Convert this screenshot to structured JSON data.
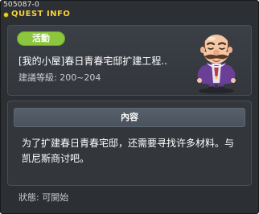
{
  "window": {
    "quest_id": "505087-0",
    "title": "QUEST INFO"
  },
  "quest": {
    "status_badge": "活動",
    "name": "[我的小屋]春日青春宅邸扩建工程..",
    "level_label": "建議等級: 200~204",
    "npc_icon": "npc-portrait-bald-mustache-noble"
  },
  "content": {
    "header": "內容",
    "lines": [
      "为了扩建春日青春宅邸，还需要寻找许多材料。与",
      "凯尼斯商讨吧。"
    ]
  },
  "status": {
    "text": "狀態:  可開始"
  },
  "colors": {
    "window_bg": "#2c2f33",
    "title": "#f6d33a",
    "badge": "#8cc63f",
    "section_header": "#4f5863",
    "text": "#ffffff",
    "muted_text": "#c6c9ce"
  }
}
